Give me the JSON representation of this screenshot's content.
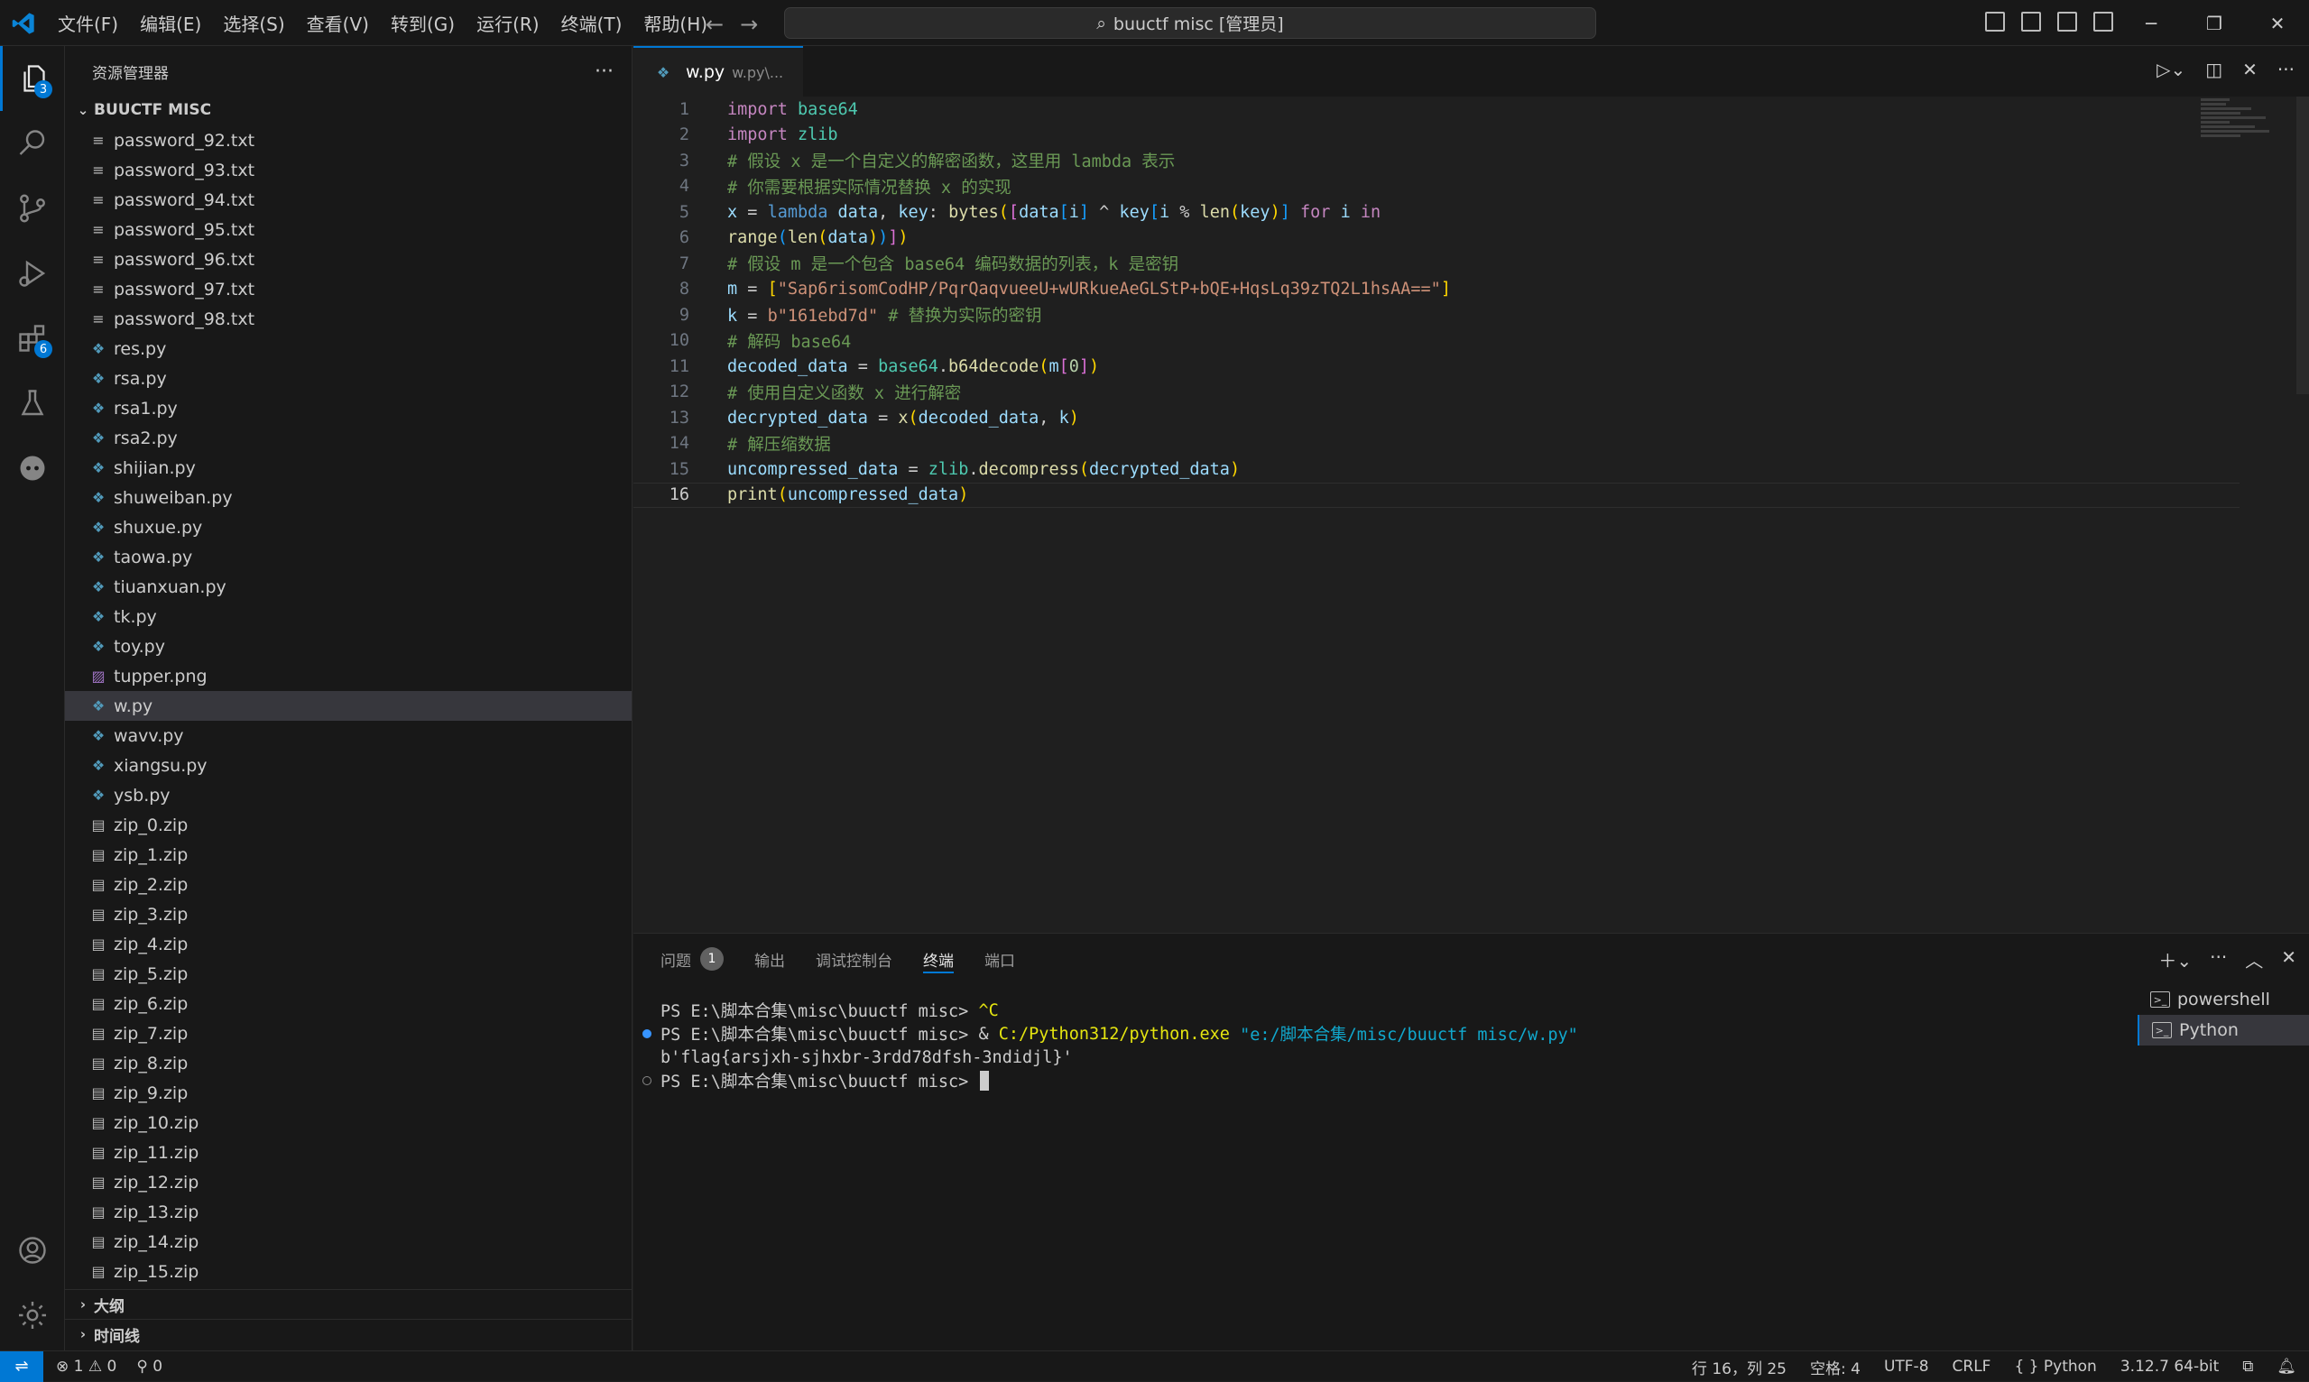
{
  "titlebar": {
    "menu": [
      "文件(F)",
      "编辑(E)",
      "选择(S)",
      "查看(V)",
      "转到(G)",
      "运行(R)",
      "终端(T)",
      "帮助(H)"
    ],
    "search_text": "buuctf misc [管理员]"
  },
  "activity": {
    "explorer_badge": "3",
    "extensions_badge": "6"
  },
  "sidebar": {
    "title": "资源管理器",
    "folder": "BUUCTF MISC",
    "files": [
      {
        "name": "password_92.txt",
        "type": "txt"
      },
      {
        "name": "password_93.txt",
        "type": "txt"
      },
      {
        "name": "password_94.txt",
        "type": "txt"
      },
      {
        "name": "password_95.txt",
        "type": "txt"
      },
      {
        "name": "password_96.txt",
        "type": "txt"
      },
      {
        "name": "password_97.txt",
        "type": "txt"
      },
      {
        "name": "password_98.txt",
        "type": "txt"
      },
      {
        "name": "res.py",
        "type": "py"
      },
      {
        "name": "rsa.py",
        "type": "py"
      },
      {
        "name": "rsa1.py",
        "type": "py"
      },
      {
        "name": "rsa2.py",
        "type": "py"
      },
      {
        "name": "shijian.py",
        "type": "py"
      },
      {
        "name": "shuweiban.py",
        "type": "py"
      },
      {
        "name": "shuxue.py",
        "type": "py"
      },
      {
        "name": "taowa.py",
        "type": "py"
      },
      {
        "name": "tiuanxuan.py",
        "type": "py"
      },
      {
        "name": "tk.py",
        "type": "py"
      },
      {
        "name": "toy.py",
        "type": "py"
      },
      {
        "name": "tupper.png",
        "type": "png"
      },
      {
        "name": "w.py",
        "type": "py",
        "selected": true
      },
      {
        "name": "wavv.py",
        "type": "py"
      },
      {
        "name": "xiangsu.py",
        "type": "py"
      },
      {
        "name": "ysb.py",
        "type": "py"
      },
      {
        "name": "zip_0.zip",
        "type": "zip"
      },
      {
        "name": "zip_1.zip",
        "type": "zip"
      },
      {
        "name": "zip_2.zip",
        "type": "zip"
      },
      {
        "name": "zip_3.zip",
        "type": "zip"
      },
      {
        "name": "zip_4.zip",
        "type": "zip"
      },
      {
        "name": "zip_5.zip",
        "type": "zip"
      },
      {
        "name": "zip_6.zip",
        "type": "zip"
      },
      {
        "name": "zip_7.zip",
        "type": "zip"
      },
      {
        "name": "zip_8.zip",
        "type": "zip"
      },
      {
        "name": "zip_9.zip",
        "type": "zip"
      },
      {
        "name": "zip_10.zip",
        "type": "zip"
      },
      {
        "name": "zip_11.zip",
        "type": "zip"
      },
      {
        "name": "zip_12.zip",
        "type": "zip"
      },
      {
        "name": "zip_13.zip",
        "type": "zip"
      },
      {
        "name": "zip_14.zip",
        "type": "zip"
      },
      {
        "name": "zip_15.zip",
        "type": "zip"
      }
    ],
    "outline_label": "大纲",
    "timeline_label": "时间线"
  },
  "editor": {
    "tab_name": "w.py",
    "tab_desc": "w.py\\...",
    "current_line": 16,
    "lines": [
      [
        [
          "import",
          "kw"
        ],
        [
          " ",
          ""
        ],
        [
          "base64",
          "mod"
        ]
      ],
      [
        [
          "import",
          "kw"
        ],
        [
          " ",
          ""
        ],
        [
          "zlib",
          "mod"
        ]
      ],
      [
        [
          "# 假设 x 是一个自定义的解密函数，这里用 lambda 表示",
          "cm"
        ]
      ],
      [
        [
          "# 你需要根据实际情况替换 x 的实现",
          "cm"
        ]
      ],
      [
        [
          "x",
          "id"
        ],
        [
          " = ",
          ""
        ],
        [
          "lambda",
          "kw2"
        ],
        [
          " ",
          ""
        ],
        [
          "data",
          "id"
        ],
        [
          ", ",
          ""
        ],
        [
          "key",
          "id"
        ],
        [
          ": ",
          ""
        ],
        [
          "bytes",
          "fn"
        ],
        [
          "(",
          "br1"
        ],
        [
          "[",
          "br2"
        ],
        [
          "data",
          "id"
        ],
        [
          "[",
          "br3"
        ],
        [
          "i",
          "id"
        ],
        [
          "]",
          "br3"
        ],
        [
          " ^ ",
          ""
        ],
        [
          "key",
          "id"
        ],
        [
          "[",
          "br3"
        ],
        [
          "i",
          "id"
        ],
        [
          " % ",
          ""
        ],
        [
          "len",
          "fn"
        ],
        [
          "(",
          "br1"
        ],
        [
          "key",
          "id"
        ],
        [
          ")",
          "br1"
        ],
        [
          "]",
          "br3"
        ],
        [
          " ",
          ""
        ],
        [
          "for",
          "kw"
        ],
        [
          " ",
          ""
        ],
        [
          "i",
          "id"
        ],
        [
          " ",
          ""
        ],
        [
          "in",
          "kw"
        ]
      ],
      [
        [
          "range",
          "fn"
        ],
        [
          "(",
          "br3"
        ],
        [
          "len",
          "fn"
        ],
        [
          "(",
          "br1"
        ],
        [
          "data",
          "id"
        ],
        [
          ")",
          "br1"
        ],
        [
          ")",
          "br3"
        ],
        [
          "]",
          "br2"
        ],
        [
          ")",
          "br1"
        ]
      ],
      [
        [
          "# 假设 m 是一个包含 base64 编码数据的列表，k 是密钥",
          "cm"
        ]
      ],
      [
        [
          "m",
          "id"
        ],
        [
          " = ",
          ""
        ],
        [
          "[",
          "br1"
        ],
        [
          "\"Sap6risomCodHP/PqrQaqvueeU+wURkueAeGLStP+bQE+HqsLq39zTQ2L1hsAA==\"",
          "str"
        ],
        [
          "]",
          "br1"
        ]
      ],
      [
        [
          "k",
          "id"
        ],
        [
          " = ",
          ""
        ],
        [
          "b\"161ebd7d\"",
          "str"
        ],
        [
          " ",
          ""
        ],
        [
          "# 替换为实际的密钥",
          "cm"
        ]
      ],
      [
        [
          "# 解码 base64",
          "cm"
        ]
      ],
      [
        [
          "decoded_data",
          "id"
        ],
        [
          " = ",
          ""
        ],
        [
          "base64",
          "mod"
        ],
        [
          ".",
          ""
        ],
        [
          "b64decode",
          "fn"
        ],
        [
          "(",
          "br1"
        ],
        [
          "m",
          "id"
        ],
        [
          "[",
          "br2"
        ],
        [
          "0",
          "num"
        ],
        [
          "]",
          "br2"
        ],
        [
          ")",
          "br1"
        ]
      ],
      [
        [
          "# 使用自定义函数 x 进行解密",
          "cm"
        ]
      ],
      [
        [
          "decrypted_data",
          "id"
        ],
        [
          " = ",
          ""
        ],
        [
          "x",
          "fn"
        ],
        [
          "(",
          "br1"
        ],
        [
          "decoded_data",
          "id"
        ],
        [
          ", ",
          ""
        ],
        [
          "k",
          "id"
        ],
        [
          ")",
          "br1"
        ]
      ],
      [
        [
          "# 解压缩数据",
          "cm"
        ]
      ],
      [
        [
          "uncompressed_data",
          "id"
        ],
        [
          " = ",
          ""
        ],
        [
          "zlib",
          "mod"
        ],
        [
          ".",
          ""
        ],
        [
          "decompress",
          "fn"
        ],
        [
          "(",
          "br1"
        ],
        [
          "decrypted_data",
          "id"
        ],
        [
          ")",
          "br1"
        ]
      ],
      [
        [
          "print",
          "fn"
        ],
        [
          "(",
          "br1"
        ],
        [
          "uncompressed_data",
          "id"
        ],
        [
          ")",
          "br1"
        ]
      ]
    ]
  },
  "panel": {
    "tabs": [
      "问题",
      "输出",
      "调试控制台",
      "终端",
      "端口"
    ],
    "problems_count": "1",
    "active_tab": "终端",
    "terminal_lines": [
      {
        "marker": "none",
        "parts": [
          [
            "PS E:\\脚本合集\\misc\\buuctf misc> ",
            "default"
          ],
          [
            "^C",
            "yellow"
          ]
        ]
      },
      {
        "marker": "blue",
        "parts": [
          [
            "PS E:\\脚本合集\\misc\\buuctf misc> ",
            "default"
          ],
          [
            "& ",
            "default"
          ],
          [
            "C:/Python312/python.exe",
            "yellow"
          ],
          [
            " ",
            "default"
          ],
          [
            "\"e:/脚本合集/misc/buuctf misc/w.py\"",
            "cyan"
          ]
        ]
      },
      {
        "marker": "none",
        "parts": [
          [
            "b'flag{arsjxh-sjhxbr-3rdd78dfsh-3ndidjl}'",
            "default"
          ]
        ]
      },
      {
        "marker": "hollow",
        "parts": [
          [
            "PS E:\\脚本合集\\misc\\buuctf misc> ",
            "default"
          ]
        ],
        "cursor": true
      }
    ],
    "terminals": [
      "powershell",
      "Python"
    ]
  },
  "statusbar": {
    "errors": "1",
    "warnings": "0",
    "ports": "0",
    "position": "行 16，列 25",
    "spaces": "空格: 4",
    "encoding": "UTF-8",
    "eol": "CRLF",
    "language": "Python",
    "interpreter": "3.12.7 64-bit"
  }
}
